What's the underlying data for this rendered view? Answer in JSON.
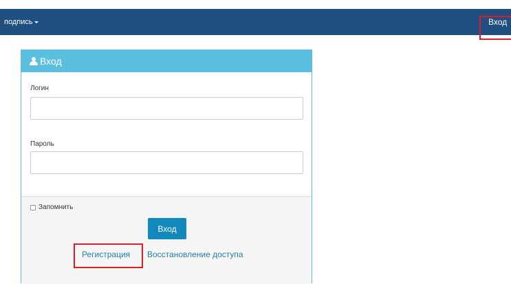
{
  "topbar": {
    "dropdown_label": "подпись",
    "login_label": "Вход",
    "background": "#1f4e80"
  },
  "panel": {
    "title": "Вход",
    "title_icon": "user-icon",
    "login_label": "Логин",
    "login_value": "",
    "password_label": "Пароль",
    "password_value": "",
    "remember_label": "Запомнить",
    "submit_label": "Вход",
    "register_link": "Регистрация",
    "recover_link": "Восстановление доступа",
    "accent": "#5bc0de",
    "button_color": "#1189bb",
    "link_color": "#1f7fb5"
  },
  "highlight_color": "#e11b22"
}
